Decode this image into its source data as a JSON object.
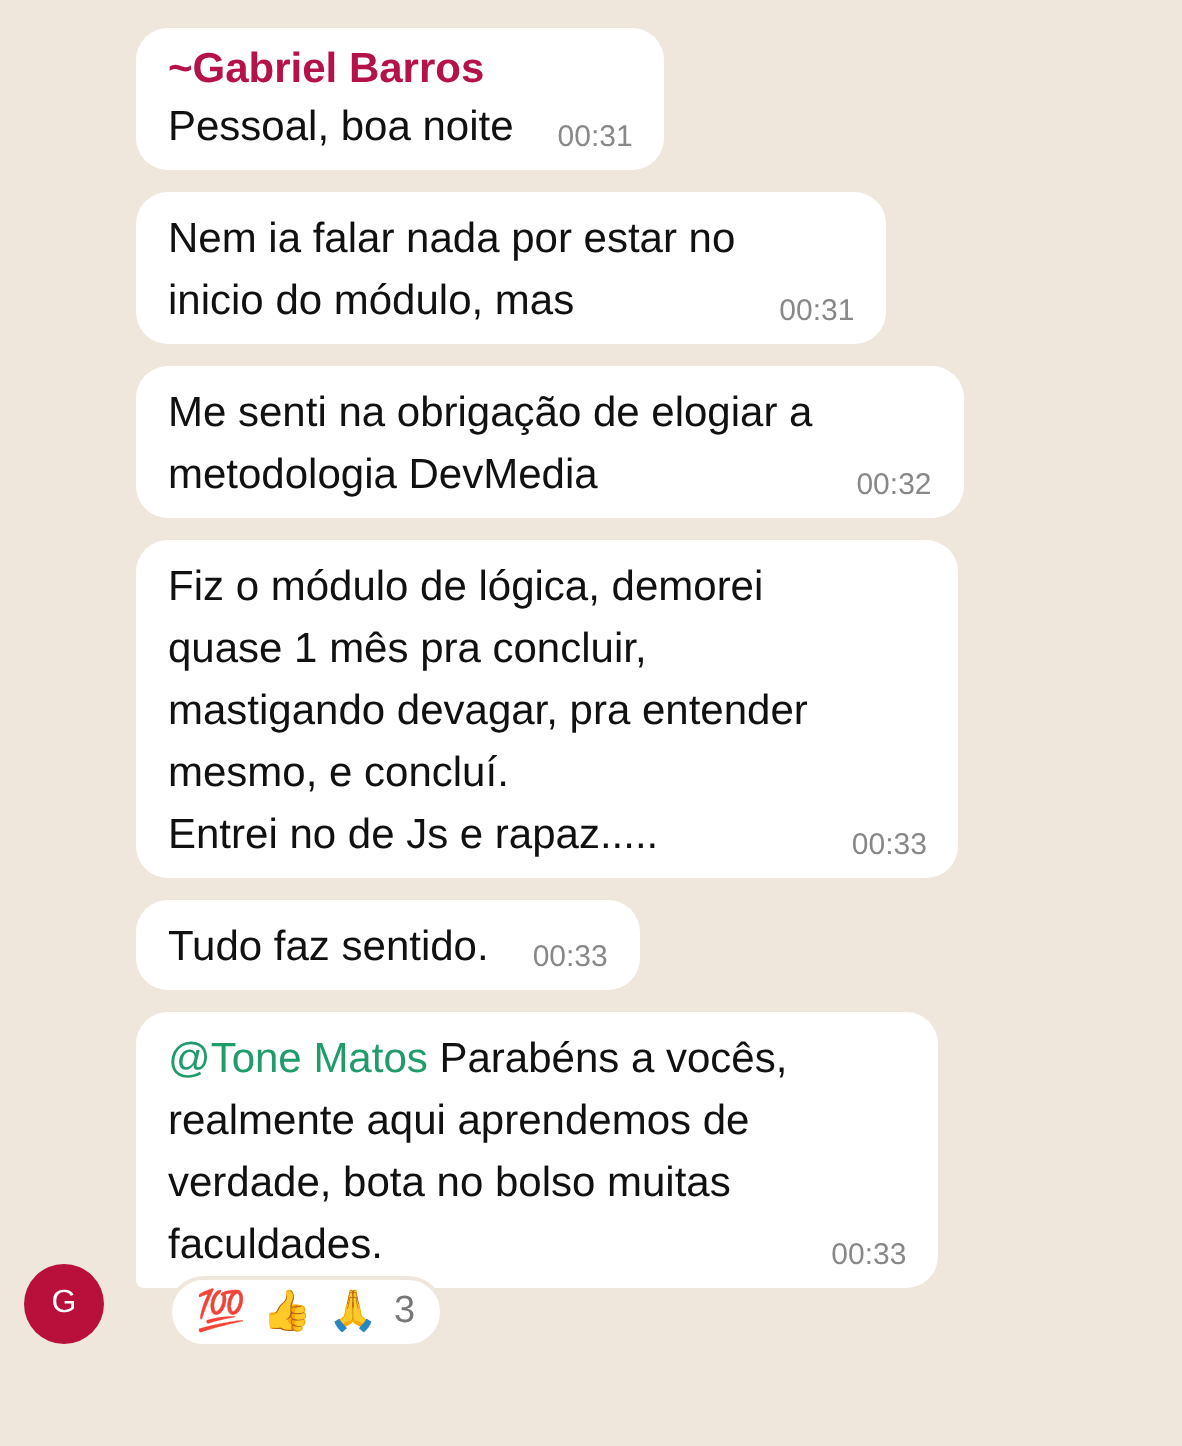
{
  "messages": [
    {
      "sender": "~Gabriel Barros",
      "text": "Pessoal, boa noite",
      "time": "00:31"
    },
    {
      "text": "Nem ia falar nada por estar no\ninicio do módulo, mas",
      "time": "00:31"
    },
    {
      "text": "Me senti na obrigação de elogiar a\nmetodologia DevMedia",
      "time": "00:32"
    },
    {
      "text": "Fiz o módulo de lógica, demorei\nquase 1 mês pra concluir,\nmastigando devagar, pra entender\nmesmo, e concluí.\nEntrei no de Js e rapaz.....",
      "time": "00:33"
    },
    {
      "text": "Tudo faz sentido.",
      "time": "00:33"
    },
    {
      "mention": "@Tone Matos",
      "text": " Parabéns a vocês,\nrealmente aqui aprendemos de\nverdade, bota no bolso muitas\nfaculdades.",
      "time": "00:33",
      "avatar": "G",
      "reactions": [
        "💯",
        "👍",
        "🙏"
      ],
      "reaction_count": "3"
    }
  ]
}
